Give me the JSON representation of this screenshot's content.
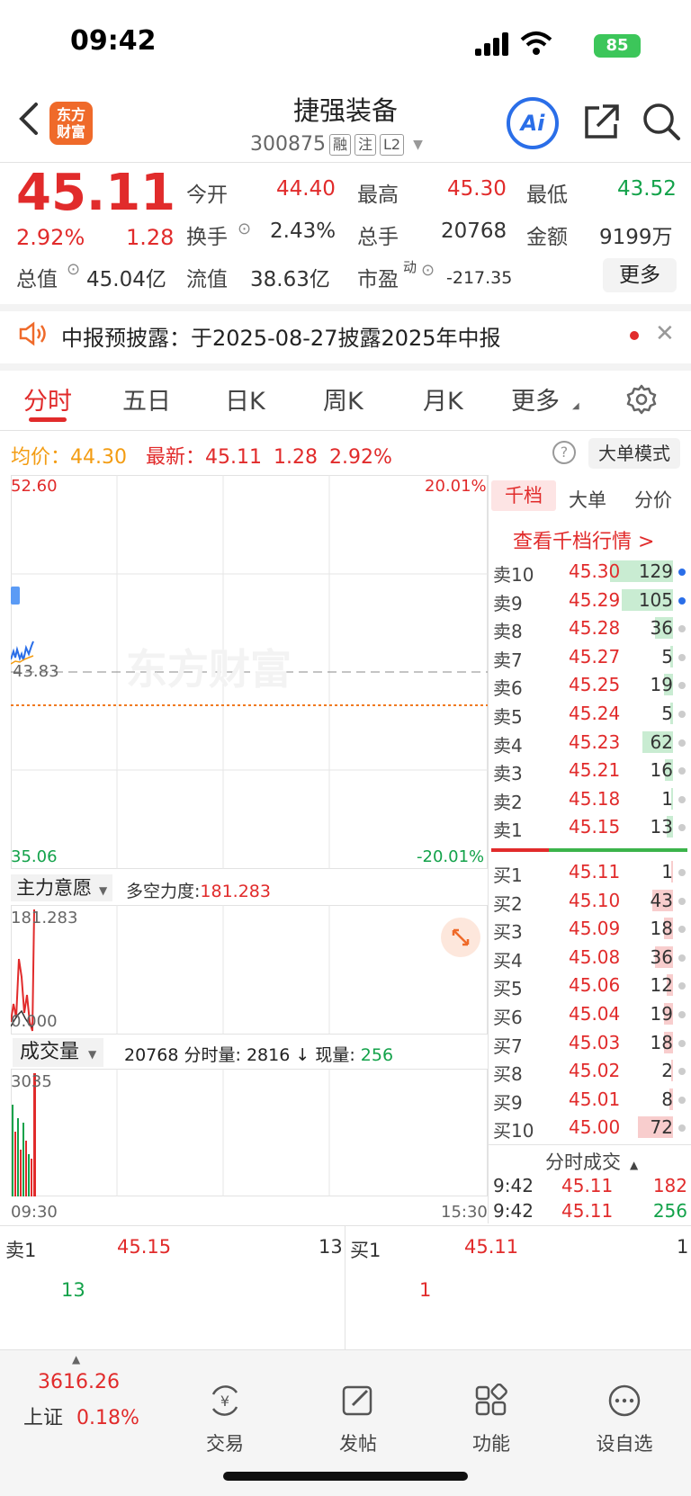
{
  "status_bar": {
    "time": "09:42",
    "battery": "85"
  },
  "header": {
    "logo_line1": "东方",
    "logo_line2": "财富",
    "stock_name": "捷强装备",
    "stock_code": "300875",
    "tags": [
      "融",
      "注",
      "L2"
    ],
    "ai_label": "Ai"
  },
  "quote": {
    "price": "45.11",
    "change_pct": "2.92%",
    "change": "1.28",
    "open_label": "今开",
    "open": "44.40",
    "high_label": "最高",
    "high": "45.30",
    "low_label": "最低",
    "low": "43.52",
    "turnover_label": "换手",
    "turnover": "2.43%",
    "volume_label": "总手",
    "volume": "20768",
    "amount_label": "金额",
    "amount": "9199万",
    "mktcap_label": "总值",
    "mktcap": "45.04亿",
    "float_label": "流值",
    "float_cap": "38.63亿",
    "pe_label": "市盈",
    "pe_sup": "动",
    "pe": "-217.35",
    "more_label": "更多"
  },
  "notice": {
    "text": "中报预披露：于2025-08-27披露2025年中报"
  },
  "tabs": [
    "分时",
    "五日",
    "日K",
    "周K",
    "月K",
    "更多"
  ],
  "info_line": {
    "avg_label": "均价：",
    "avg": "44.30",
    "latest_label": "最新：",
    "latest": "45.11",
    "change": "1.28",
    "pct": "2.92%",
    "mode_button": "大单模式"
  },
  "price_chart": {
    "y_top": "52.60",
    "y_mid": "43.83",
    "y_bottom": "35.06",
    "pct_top": "20.01%",
    "pct_bottom": "-20.01%",
    "watermark": "东方财富"
  },
  "indicator": {
    "selector": "主力意愿",
    "label": "多空力度:",
    "value": "181.283",
    "y_top": "181.283",
    "y_bottom": "0.000"
  },
  "volume_panel": {
    "selector": "成交量",
    "total": "20768",
    "minute_label": "分时量:",
    "minute_vol": "2816",
    "current_label": "现量:",
    "current_vol": "256",
    "y_top": "3035",
    "x_start": "09:30",
    "x_end": "15:30"
  },
  "orderbook": {
    "tabs": [
      "千档",
      "大单",
      "分价"
    ],
    "link": "查看千档行情 >",
    "asks": [
      {
        "label": "卖10",
        "price": "45.30",
        "vol": "129"
      },
      {
        "label": "卖9",
        "price": "45.29",
        "vol": "105"
      },
      {
        "label": "卖8",
        "price": "45.28",
        "vol": "36"
      },
      {
        "label": "卖7",
        "price": "45.27",
        "vol": "5"
      },
      {
        "label": "卖6",
        "price": "45.25",
        "vol": "19"
      },
      {
        "label": "卖5",
        "price": "45.24",
        "vol": "5"
      },
      {
        "label": "卖4",
        "price": "45.23",
        "vol": "62"
      },
      {
        "label": "卖3",
        "price": "45.21",
        "vol": "16"
      },
      {
        "label": "卖2",
        "price": "45.18",
        "vol": "1"
      },
      {
        "label": "卖1",
        "price": "45.15",
        "vol": "13"
      }
    ],
    "bids": [
      {
        "label": "买1",
        "price": "45.11",
        "vol": "1"
      },
      {
        "label": "买2",
        "price": "45.10",
        "vol": "43"
      },
      {
        "label": "买3",
        "price": "45.09",
        "vol": "18"
      },
      {
        "label": "买4",
        "price": "45.08",
        "vol": "36"
      },
      {
        "label": "买5",
        "price": "45.06",
        "vol": "12"
      },
      {
        "label": "买6",
        "price": "45.04",
        "vol": "19"
      },
      {
        "label": "买7",
        "price": "45.03",
        "vol": "18"
      },
      {
        "label": "买8",
        "price": "45.02",
        "vol": "2"
      },
      {
        "label": "买9",
        "price": "45.01",
        "vol": "8"
      },
      {
        "label": "买10",
        "price": "45.00",
        "vol": "72"
      }
    ],
    "trades_title": "分时成交",
    "trades": [
      {
        "time": "9:42",
        "price": "45.11",
        "vol": "182"
      },
      {
        "time": "9:42",
        "price": "45.11",
        "vol": "256"
      }
    ]
  },
  "level1": {
    "sell_label": "卖1",
    "sell_price": "45.15",
    "sell_vol": "13",
    "sell_detail": "13",
    "buy_label": "买1",
    "buy_price": "45.11",
    "buy_vol": "1",
    "buy_detail": "1"
  },
  "bottom_nav": {
    "index_value": "3616.26",
    "index_name": "上证",
    "index_pct": "0.18%",
    "items": [
      "交易",
      "发帖",
      "功能",
      "设自选"
    ]
  },
  "colors": {
    "up": "#e12b2b",
    "down": "#13a24a",
    "avg": "#f39c12",
    "ask_bar": "#c9ecd2",
    "bid_bar": "#f8cdcd",
    "accent": "#2a6ee8"
  }
}
